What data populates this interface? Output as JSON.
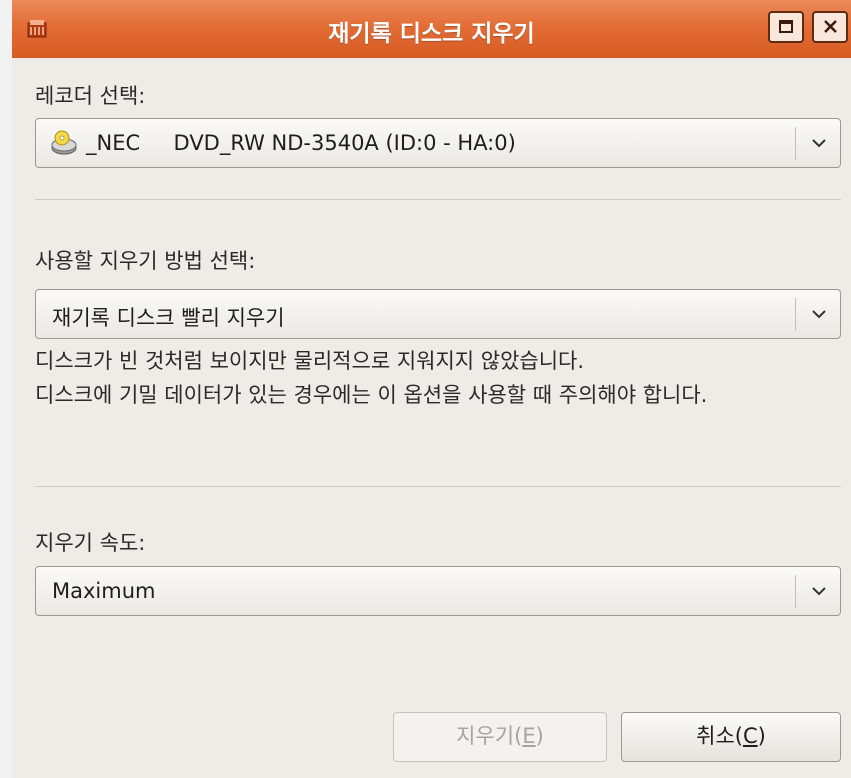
{
  "window": {
    "title": "재기록 디스크 지우기",
    "colors": {
      "titlebar": "#e36d36",
      "background": "#efebe7"
    }
  },
  "recorder": {
    "label": "레코더 선택:",
    "selected": "_NEC     DVD_RW ND-3540A (ID:0 - HA:0)",
    "icon": "optical-drive-icon"
  },
  "method": {
    "label": "사용할 지우기 방법 선택:",
    "selected": "재기록 디스크 빨리 지우기",
    "description_line1": "디스크가 빈 것처럼 보이지만 물리적으로 지워지지 않았습니다.",
    "description_line2": "디스크에 기밀 데이터가 있는 경우에는 이 옵션을 사용할 때 주의해야 합니다."
  },
  "speed": {
    "label": "지우기 속도:",
    "selected": "Maximum"
  },
  "buttons": {
    "erase_label": "지우기(",
    "erase_mnemonic": "E",
    "erase_suffix": ")",
    "cancel_label": "취소(",
    "cancel_mnemonic": "C",
    "cancel_suffix": ")"
  }
}
